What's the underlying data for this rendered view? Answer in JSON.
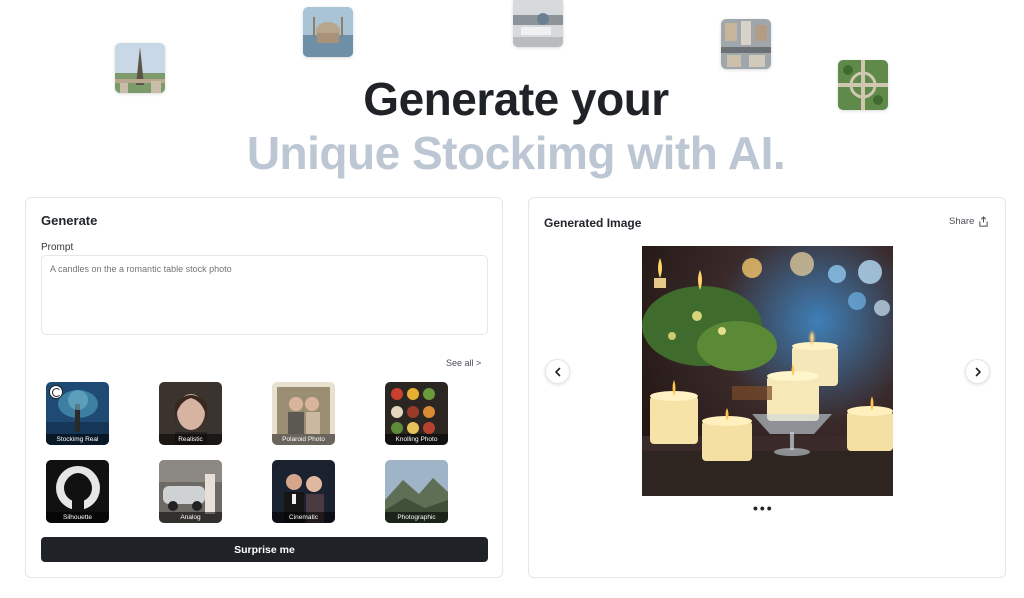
{
  "hero": {
    "line1": "Generate your",
    "line2": "Unique Stockimg with AI."
  },
  "generate_panel": {
    "title": "Generate",
    "prompt_label": "Prompt",
    "prompt_placeholder": "A candles on the a romantic table stock photo",
    "prompt_value": "",
    "see_all": "See all >",
    "styles": [
      {
        "label": "Stockimg Real",
        "selected": true
      },
      {
        "label": "Realistic"
      },
      {
        "label": "Polaroid Photo"
      },
      {
        "label": "Knolling Photo"
      },
      {
        "label": "Silhouette"
      },
      {
        "label": "Analog"
      },
      {
        "label": "Cinematic"
      },
      {
        "label": "Photographic"
      }
    ],
    "surprise_button": "Surprise me"
  },
  "image_panel": {
    "title": "Generated Image",
    "share_label": "Share",
    "more_label": "•••"
  },
  "colors": {
    "dark": "#1f2227",
    "hero_accent": "#bcc7d3",
    "border": "#e3e6ea"
  }
}
